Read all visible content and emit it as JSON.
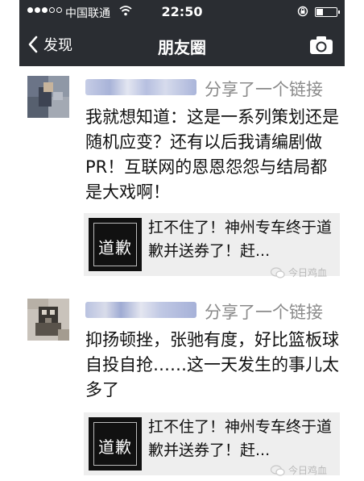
{
  "status_bar": {
    "carrier": "中国联通",
    "time": "22:50"
  },
  "nav": {
    "back_label": "发现",
    "title": "朋友圈"
  },
  "posts": [
    {
      "shared_label": "分享了一个链接",
      "body": "我就想知道：这是一系列策划还是随机应变？还有以后我请编剧做PR！互联网的恩恩怨怨与结局都是大戏啊！",
      "link": {
        "thumb_text": "道歉",
        "title": "扛不住了！神州专车终于道歉并送券了！赶..."
      },
      "watermark": "今日鸡血"
    },
    {
      "shared_label": "分享了一个链接",
      "body": "抑扬顿挫，张驰有度，好比篮板球自投自抢……这一天发生的事儿太多了",
      "link": {
        "thumb_text": "道歉",
        "title": "扛不住了！神州专车终于道歉并送券了！赶..."
      },
      "watermark": "今日鸡血"
    }
  ]
}
